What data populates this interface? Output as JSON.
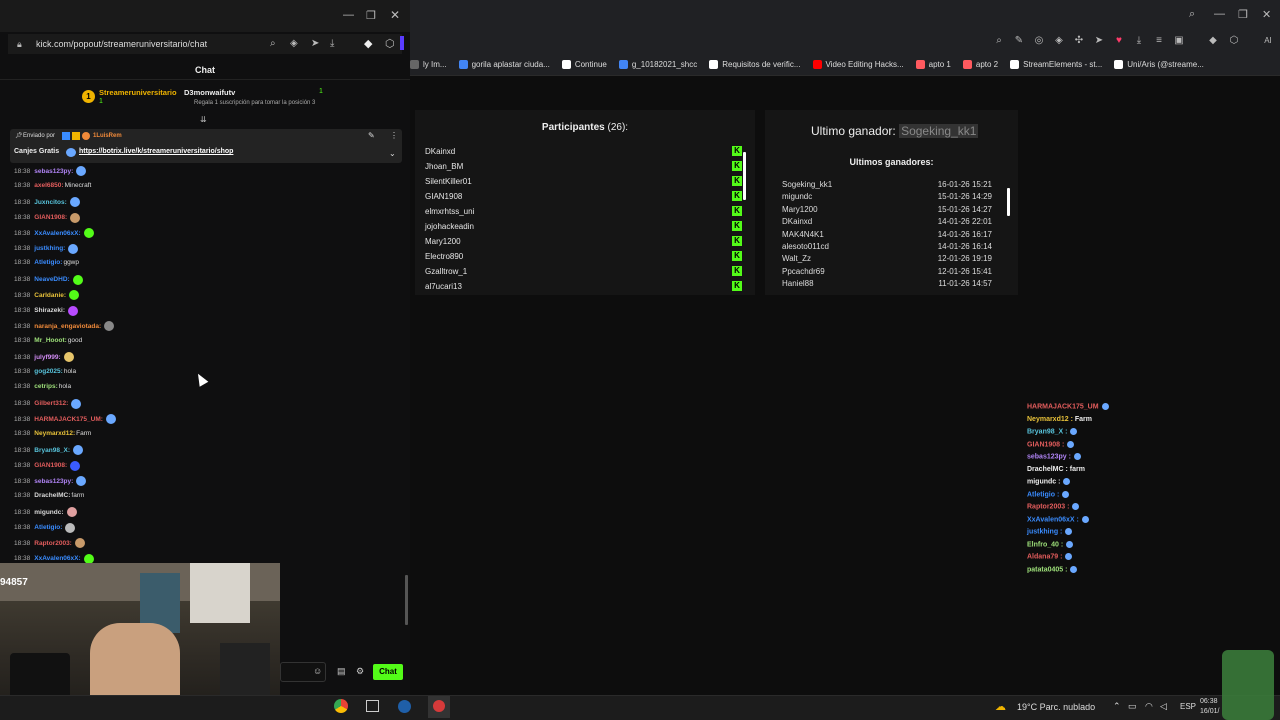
{
  "colors": {
    "kick_green": "#53fc18",
    "bg": "#0b0b0b",
    "panel": "#151515"
  },
  "left_window": {
    "url": "kick.com/popout/streameruniversitario/chat",
    "chat_title": "Chat",
    "sub_gift": {
      "streamer": "Streameruniversitario",
      "streamer_count": "1",
      "user": "D3monwaifutv",
      "user_count": "1",
      "note": "Regala 1 suscripción para tomar la posición 3"
    },
    "pinned": {
      "sent_by": "Enviado por",
      "pinned_user": "1LuisRem",
      "text": "Canjes Gratis",
      "link": "https://botrix.live/k/streameruniversitario/shop"
    },
    "messages": [
      {
        "time": "18:38",
        "user": "sebas123py:",
        "color": "#b084f5",
        "text": "",
        "emote": "#6aa8ff"
      },
      {
        "time": "18:38",
        "user": "axel6850:",
        "color": "#e35d5d",
        "text": "Minecraft",
        "emote": ""
      },
      {
        "time": "18:38",
        "user": "Juxncitos:",
        "color": "#58c4dc",
        "text": "",
        "emote": "#6aa8ff"
      },
      {
        "time": "18:38",
        "user": "GIAN1908:",
        "color": "#e35d5d",
        "text": "",
        "emote": "#c89a6a"
      },
      {
        "time": "18:38",
        "user": "XxAvalen06xX:",
        "color": "#3a8cff",
        "text": "",
        "emote": "#53fc18"
      },
      {
        "time": "18:38",
        "user": "justkhing:",
        "color": "#3a8cff",
        "text": "",
        "emote": "#6aa8ff"
      },
      {
        "time": "18:38",
        "user": "Atletigio:",
        "color": "#3a8cff",
        "text": "ggwp",
        "emote": ""
      },
      {
        "time": "18:38",
        "user": "NeaveDHD:",
        "color": "#3a8cff",
        "text": "",
        "emote": "#53fc18"
      },
      {
        "time": "18:38",
        "user": "Carldanie:",
        "color": "#e8c23a",
        "text": "",
        "emote": "#53fc18"
      },
      {
        "time": "18:38",
        "user": "Shirazeki:",
        "color": "#d9d9d9",
        "text": "",
        "emote": "#b84bff"
      },
      {
        "time": "18:38",
        "user": "naranja_engaviotada:",
        "color": "#f08a3a",
        "text": "",
        "emote": "#888888"
      },
      {
        "time": "18:38",
        "user": "Mr_Hooot:",
        "color": "#9ee07a",
        "text": "good",
        "emote": ""
      },
      {
        "time": "18:38",
        "user": "julyf999:",
        "color": "#d28cf5",
        "text": "",
        "emote": "#e6c56a"
      },
      {
        "time": "18:38",
        "user": "gog2025:",
        "color": "#58c4dc",
        "text": "hola",
        "emote": ""
      },
      {
        "time": "18:38",
        "user": "cetrips:",
        "color": "#9ee07a",
        "text": "hola",
        "emote": ""
      },
      {
        "time": "18:38",
        "user": "Gilbert312:",
        "color": "#e35d5d",
        "text": "",
        "emote": "#6aa8ff"
      },
      {
        "time": "18:38",
        "user": "HARMAJACK175_UM:",
        "color": "#e35d5d",
        "text": "",
        "emote": "#6aa8ff"
      },
      {
        "time": "18:38",
        "user": "Neymarxd12:",
        "color": "#e8c23a",
        "text": "Farm",
        "emote": ""
      },
      {
        "time": "18:38",
        "user": "Bryan98_X:",
        "color": "#58c4dc",
        "text": "",
        "emote": "#6aa8ff"
      },
      {
        "time": "18:38",
        "user": "GIAN1908:",
        "color": "#e35d5d",
        "text": "",
        "emote": "#3a5cff"
      },
      {
        "time": "18:38",
        "user": "sebas123py:",
        "color": "#b084f5",
        "text": "",
        "emote": "#6aa8ff"
      },
      {
        "time": "18:38",
        "user": "DrachelMC:",
        "color": "#d9d9d9",
        "text": "farm",
        "emote": ""
      },
      {
        "time": "18:38",
        "user": "migundc:",
        "color": "#d9d9d9",
        "text": "",
        "emote": "#e0a0a0"
      },
      {
        "time": "18:38",
        "user": "Atletigio:",
        "color": "#3a8cff",
        "text": "",
        "emote": "#bbbbbb"
      },
      {
        "time": "18:38",
        "user": "Raptor2003:",
        "color": "#e35d5d",
        "text": "",
        "emote": "#c89a6a"
      },
      {
        "time": "18:38",
        "user": "XxAvalen06xX:",
        "color": "#3a8cff",
        "text": "",
        "emote": "#53fc18"
      }
    ],
    "webcam_label": "94857",
    "chat_button": "Chat"
  },
  "right_window": {
    "bookmarks": [
      "ly Im...",
      "gorila aplastar ciuda...",
      "Continue",
      "g_10182021_shcc",
      "Requisitos de verific...",
      "Video Editing Hacks...",
      "apto 1",
      "apto 2",
      "StreamElements - st...",
      "Uni/Aris (@streame..."
    ],
    "bookmark_colors": [
      "#666666",
      "#4285f4",
      "#ffffff",
      "#4285f4",
      "#ffffff",
      "#ff0000",
      "#ff5a5f",
      "#ff5a5f",
      "#ffffff",
      "#ffffff"
    ],
    "participants_label": "Participantes",
    "participants_count": "(26):",
    "participants": [
      "DKainxd",
      "Jhoan_BM",
      "SilentKiller01",
      "GIAN1908",
      "elmxrhtss_uni",
      "jojohackeadin",
      "Mary1200",
      "Electro890",
      "Gzalltrow_1",
      "al7ucari13"
    ],
    "k_badge": "K",
    "last_winner_label": "Ultimo ganador:",
    "last_winner": "Sogeking_kk1",
    "winners_title": "Ultimos ganadores:",
    "winners": [
      {
        "name": "Sogeking_kk1",
        "date": "16-01-26 15:21"
      },
      {
        "name": "migundc",
        "date": "15-01-26 14:29"
      },
      {
        "name": "Mary1200",
        "date": "15-01-26 14:27"
      },
      {
        "name": "DKainxd",
        "date": "14-01-26 22:01"
      },
      {
        "name": "MAK4N4K1",
        "date": "14-01-26 16:17"
      },
      {
        "name": "alesoto011cd",
        "date": "14-01-26 16:14"
      },
      {
        "name": "Walt_Zz",
        "date": "12-01-26 19:19"
      },
      {
        "name": "Ppcachdr69",
        "date": "12-01-26 15:41"
      },
      {
        "name": "Haniel88",
        "date": "11-01-26 14:57"
      }
    ],
    "overlay_chat": [
      {
        "user": "HARMAJACK175_UM",
        "color": "#e35d5d",
        "text": ""
      },
      {
        "user": "Neymarxd12 :",
        "color": "#e8c23a",
        "text": "Farm"
      },
      {
        "user": "Bryan98_X :",
        "color": "#58c4dc",
        "text": ""
      },
      {
        "user": "GIAN1908 :",
        "color": "#e35d5d",
        "text": ""
      },
      {
        "user": "sebas123py :",
        "color": "#b084f5",
        "text": ""
      },
      {
        "user": "DrachelMC :",
        "color": "#eeeeee",
        "text": "farm"
      },
      {
        "user": "migundc :",
        "color": "#eeeeee",
        "text": ""
      },
      {
        "user": "Atletigio :",
        "color": "#3a8cff",
        "text": ""
      },
      {
        "user": "Raptor2003 :",
        "color": "#e35d5d",
        "text": ""
      },
      {
        "user": "XxAvalen06xX :",
        "color": "#3a8cff",
        "text": ""
      },
      {
        "user": "justkhing :",
        "color": "#3a8cff",
        "text": ""
      },
      {
        "user": "Elnfro_40 :",
        "color": "#9ee07a",
        "text": ""
      },
      {
        "user": "Aldana79 :",
        "color": "#e35d5d",
        "text": ""
      },
      {
        "user": "patata0405 :",
        "color": "#9ee07a",
        "text": ""
      }
    ]
  },
  "taskbar": {
    "weather": "19°C  Parc. nublado",
    "lang": "ESP",
    "time": "06:38",
    "date": "16/01/"
  }
}
